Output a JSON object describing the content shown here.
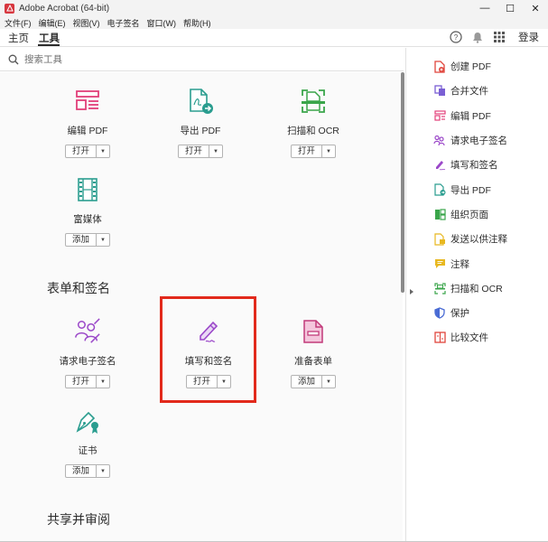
{
  "window": {
    "title": "Adobe Acrobat (64-bit)",
    "minimize": "—",
    "maximize": "☐",
    "close": "✕"
  },
  "menubar": {
    "items": [
      "文件(F)",
      "编辑(E)",
      "视图(V)",
      "电子签名",
      "窗口(W)",
      "帮助(H)"
    ]
  },
  "navbar": {
    "tabs": [
      "主页",
      "工具"
    ],
    "login": "登录"
  },
  "search": {
    "placeholder": "搜索工具"
  },
  "tools": {
    "edit_pdf": {
      "label": "编辑 PDF",
      "button": "打开"
    },
    "export_pdf": {
      "label": "导出 PDF",
      "button": "打开"
    },
    "scan_ocr": {
      "label": "扫描和 OCR",
      "button": "打开"
    },
    "rich_media": {
      "label": "富媒体",
      "button": "添加"
    },
    "request_esign": {
      "label": "请求电子签名",
      "button": "打开"
    },
    "fill_sign": {
      "label": "填写和签名",
      "button": "打开"
    },
    "prepare_form": {
      "label": "准备表单",
      "button": "添加"
    },
    "certificate": {
      "label": "证书",
      "button": "添加"
    }
  },
  "sections": {
    "forms_signatures": "表单和签名",
    "share_review": "共享并审阅"
  },
  "right_panel": {
    "items": [
      {
        "label": "创建 PDF",
        "icon": "create-pdf-icon",
        "color": "#e0453c"
      },
      {
        "label": "合并文件",
        "icon": "combine-files-icon",
        "color": "#7a5fd4"
      },
      {
        "label": "编辑 PDF",
        "icon": "edit-pdf-icon",
        "color": "#e2407a"
      },
      {
        "label": "请求电子签名",
        "icon": "request-esign-icon",
        "color": "#9b48c9"
      },
      {
        "label": "填写和签名",
        "icon": "fill-sign-icon",
        "color": "#9b48c9"
      },
      {
        "label": "导出 PDF",
        "icon": "export-pdf-icon",
        "color": "#2a9d8f"
      },
      {
        "label": "组织页面",
        "icon": "organize-pages-icon",
        "color": "#3aa54a"
      },
      {
        "label": "发送以供注释",
        "icon": "send-comments-icon",
        "color": "#e8b820"
      },
      {
        "label": "注释",
        "icon": "comment-icon",
        "color": "#e8b820"
      },
      {
        "label": "扫描和 OCR",
        "icon": "scan-ocr-icon",
        "color": "#3aa54a"
      },
      {
        "label": "保护",
        "icon": "protect-icon",
        "color": "#4a6cd4"
      },
      {
        "label": "比较文件",
        "icon": "compare-files-icon",
        "color": "#e0453c"
      }
    ]
  },
  "colors": {
    "highlight": "#e2291b",
    "pink": "#e2407a",
    "teal": "#2a9d8f",
    "green": "#3aa54a",
    "purple": "#9b48c9"
  }
}
